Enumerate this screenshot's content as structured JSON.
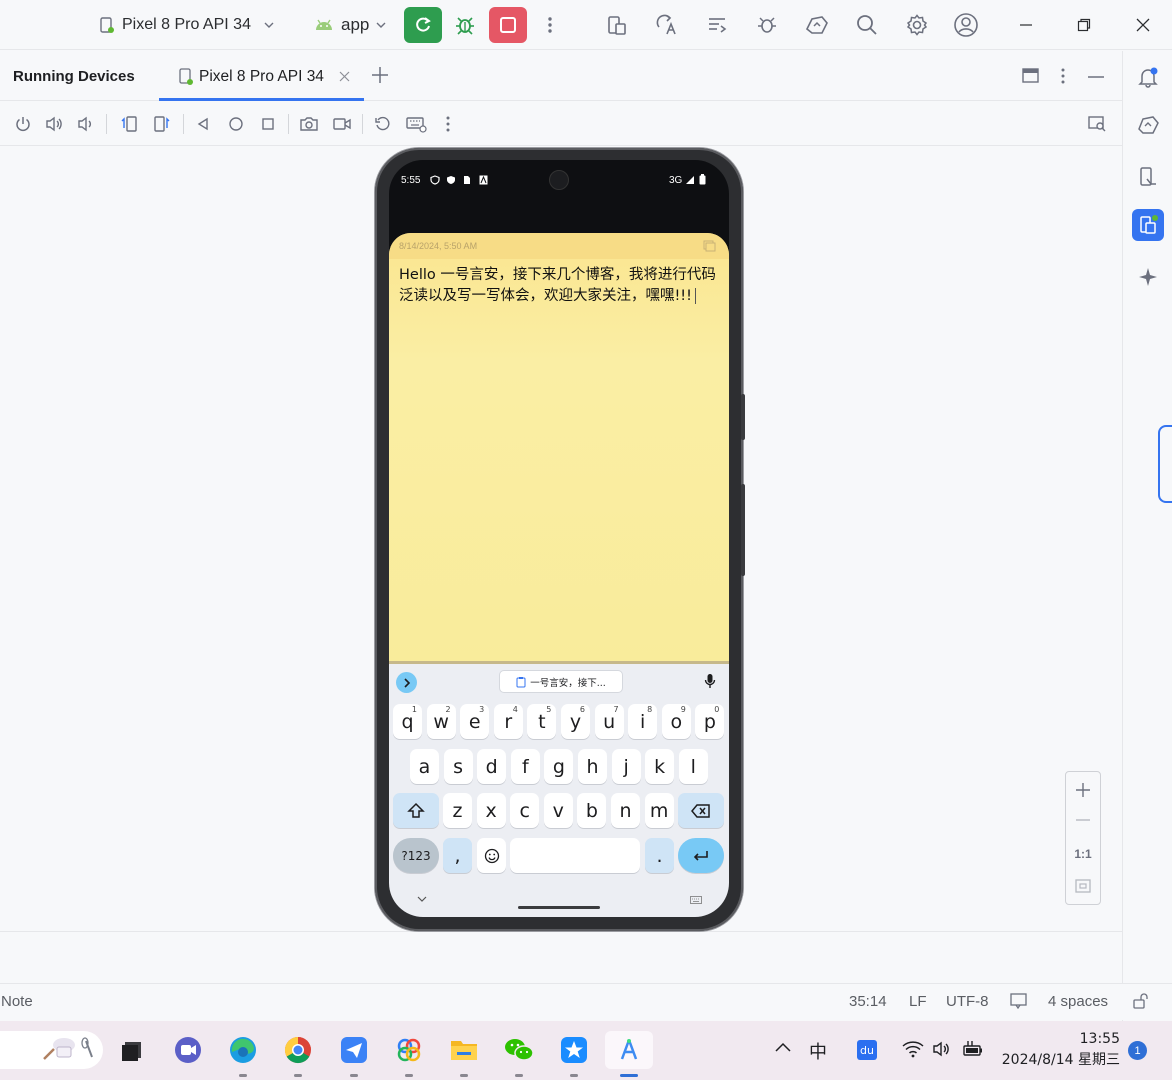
{
  "titlebar": {
    "device_selector": "Pixel 8 Pro API 34",
    "run_config": "app"
  },
  "tool_window": {
    "title": "Running Devices",
    "tab_label": "Pixel 8 Pro API 34"
  },
  "phone": {
    "time": "5:55",
    "network": "3G",
    "note_date": "8/14/2024, 5:50 AM",
    "note_text": "Hello  一号言安，接下来几个博客，我将进行代码泛读以及写一写体会，欢迎大家关注，嘿嘿!!!",
    "clipboard_suggestion": "一号言安，接下...",
    "keyboard": {
      "row1": [
        {
          "k": "q",
          "s": "1"
        },
        {
          "k": "w",
          "s": "2"
        },
        {
          "k": "e",
          "s": "3"
        },
        {
          "k": "r",
          "s": "4"
        },
        {
          "k": "t",
          "s": "5"
        },
        {
          "k": "y",
          "s": "6"
        },
        {
          "k": "u",
          "s": "7"
        },
        {
          "k": "i",
          "s": "8"
        },
        {
          "k": "o",
          "s": "9"
        },
        {
          "k": "p",
          "s": "0"
        }
      ],
      "row2": [
        "a",
        "s",
        "d",
        "f",
        "g",
        "h",
        "j",
        "k",
        "l"
      ],
      "row3": [
        "z",
        "x",
        "c",
        "v",
        "b",
        "n",
        "m"
      ],
      "symbols_key": "?123",
      "comma_key": ",",
      "period_key": "."
    }
  },
  "zoom": {
    "actual_size": "1:1"
  },
  "status_bar": {
    "left": "Note",
    "position": "35:14",
    "line_sep": "LF",
    "encoding": "UTF-8",
    "indent": "4 spaces"
  },
  "taskbar": {
    "ime": "中",
    "time": "13:55",
    "date": "2024/8/14 星期三",
    "notifications": "1"
  }
}
